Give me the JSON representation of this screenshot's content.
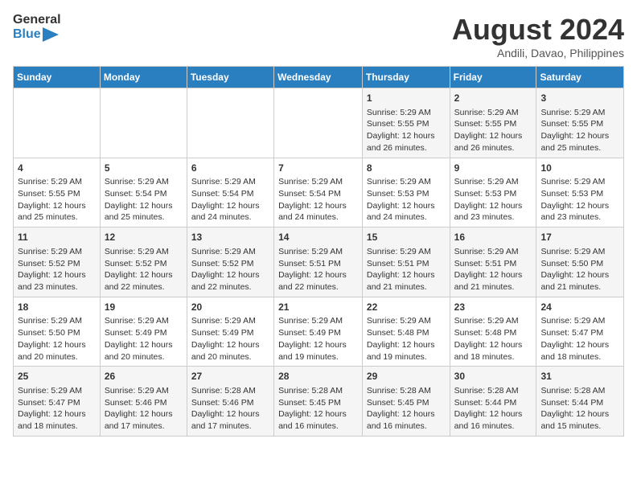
{
  "header": {
    "logo_line1": "General",
    "logo_line2": "Blue",
    "month_year": "August 2024",
    "location": "Andili, Davao, Philippines"
  },
  "days_of_week": [
    "Sunday",
    "Monday",
    "Tuesday",
    "Wednesday",
    "Thursday",
    "Friday",
    "Saturday"
  ],
  "weeks": [
    [
      {
        "day": "",
        "info": ""
      },
      {
        "day": "",
        "info": ""
      },
      {
        "day": "",
        "info": ""
      },
      {
        "day": "",
        "info": ""
      },
      {
        "day": "1",
        "info": "Sunrise: 5:29 AM\nSunset: 5:55 PM\nDaylight: 12 hours\nand 26 minutes."
      },
      {
        "day": "2",
        "info": "Sunrise: 5:29 AM\nSunset: 5:55 PM\nDaylight: 12 hours\nand 26 minutes."
      },
      {
        "day": "3",
        "info": "Sunrise: 5:29 AM\nSunset: 5:55 PM\nDaylight: 12 hours\nand 25 minutes."
      }
    ],
    [
      {
        "day": "4",
        "info": "Sunrise: 5:29 AM\nSunset: 5:55 PM\nDaylight: 12 hours\nand 25 minutes."
      },
      {
        "day": "5",
        "info": "Sunrise: 5:29 AM\nSunset: 5:54 PM\nDaylight: 12 hours\nand 25 minutes."
      },
      {
        "day": "6",
        "info": "Sunrise: 5:29 AM\nSunset: 5:54 PM\nDaylight: 12 hours\nand 24 minutes."
      },
      {
        "day": "7",
        "info": "Sunrise: 5:29 AM\nSunset: 5:54 PM\nDaylight: 12 hours\nand 24 minutes."
      },
      {
        "day": "8",
        "info": "Sunrise: 5:29 AM\nSunset: 5:53 PM\nDaylight: 12 hours\nand 24 minutes."
      },
      {
        "day": "9",
        "info": "Sunrise: 5:29 AM\nSunset: 5:53 PM\nDaylight: 12 hours\nand 23 minutes."
      },
      {
        "day": "10",
        "info": "Sunrise: 5:29 AM\nSunset: 5:53 PM\nDaylight: 12 hours\nand 23 minutes."
      }
    ],
    [
      {
        "day": "11",
        "info": "Sunrise: 5:29 AM\nSunset: 5:52 PM\nDaylight: 12 hours\nand 23 minutes."
      },
      {
        "day": "12",
        "info": "Sunrise: 5:29 AM\nSunset: 5:52 PM\nDaylight: 12 hours\nand 22 minutes."
      },
      {
        "day": "13",
        "info": "Sunrise: 5:29 AM\nSunset: 5:52 PM\nDaylight: 12 hours\nand 22 minutes."
      },
      {
        "day": "14",
        "info": "Sunrise: 5:29 AM\nSunset: 5:51 PM\nDaylight: 12 hours\nand 22 minutes."
      },
      {
        "day": "15",
        "info": "Sunrise: 5:29 AM\nSunset: 5:51 PM\nDaylight: 12 hours\nand 21 minutes."
      },
      {
        "day": "16",
        "info": "Sunrise: 5:29 AM\nSunset: 5:51 PM\nDaylight: 12 hours\nand 21 minutes."
      },
      {
        "day": "17",
        "info": "Sunrise: 5:29 AM\nSunset: 5:50 PM\nDaylight: 12 hours\nand 21 minutes."
      }
    ],
    [
      {
        "day": "18",
        "info": "Sunrise: 5:29 AM\nSunset: 5:50 PM\nDaylight: 12 hours\nand 20 minutes."
      },
      {
        "day": "19",
        "info": "Sunrise: 5:29 AM\nSunset: 5:49 PM\nDaylight: 12 hours\nand 20 minutes."
      },
      {
        "day": "20",
        "info": "Sunrise: 5:29 AM\nSunset: 5:49 PM\nDaylight: 12 hours\nand 20 minutes."
      },
      {
        "day": "21",
        "info": "Sunrise: 5:29 AM\nSunset: 5:49 PM\nDaylight: 12 hours\nand 19 minutes."
      },
      {
        "day": "22",
        "info": "Sunrise: 5:29 AM\nSunset: 5:48 PM\nDaylight: 12 hours\nand 19 minutes."
      },
      {
        "day": "23",
        "info": "Sunrise: 5:29 AM\nSunset: 5:48 PM\nDaylight: 12 hours\nand 18 minutes."
      },
      {
        "day": "24",
        "info": "Sunrise: 5:29 AM\nSunset: 5:47 PM\nDaylight: 12 hours\nand 18 minutes."
      }
    ],
    [
      {
        "day": "25",
        "info": "Sunrise: 5:29 AM\nSunset: 5:47 PM\nDaylight: 12 hours\nand 18 minutes."
      },
      {
        "day": "26",
        "info": "Sunrise: 5:29 AM\nSunset: 5:46 PM\nDaylight: 12 hours\nand 17 minutes."
      },
      {
        "day": "27",
        "info": "Sunrise: 5:28 AM\nSunset: 5:46 PM\nDaylight: 12 hours\nand 17 minutes."
      },
      {
        "day": "28",
        "info": "Sunrise: 5:28 AM\nSunset: 5:45 PM\nDaylight: 12 hours\nand 16 minutes."
      },
      {
        "day": "29",
        "info": "Sunrise: 5:28 AM\nSunset: 5:45 PM\nDaylight: 12 hours\nand 16 minutes."
      },
      {
        "day": "30",
        "info": "Sunrise: 5:28 AM\nSunset: 5:44 PM\nDaylight: 12 hours\nand 16 minutes."
      },
      {
        "day": "31",
        "info": "Sunrise: 5:28 AM\nSunset: 5:44 PM\nDaylight: 12 hours\nand 15 minutes."
      }
    ]
  ]
}
